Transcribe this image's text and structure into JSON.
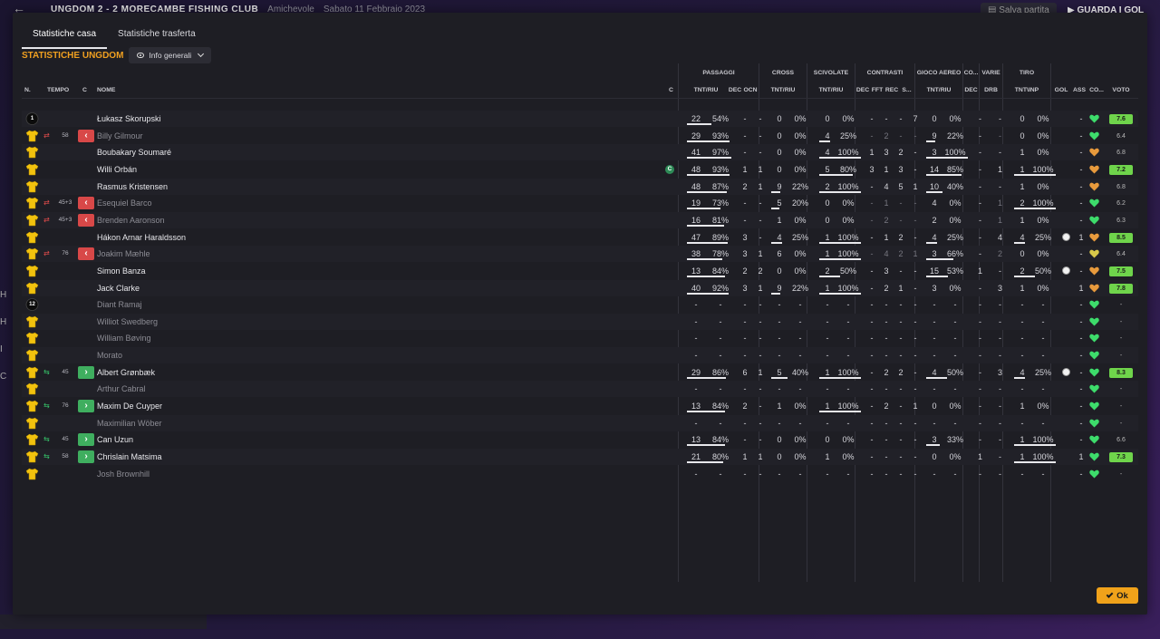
{
  "background": {
    "header_title": "UNGDOM  2 - 2  MORECAMBE FISHING CLUB",
    "header_venue": "Amichevole",
    "header_date": "Sabato 11 Febbraio 2023",
    "save_label": "Salva partita",
    "watch_label": "GUARDA I GOL",
    "left_labels": [
      "H",
      "H",
      "I",
      "C"
    ]
  },
  "tabs": [
    {
      "label": "Statistiche casa",
      "active": true
    },
    {
      "label": "Statistiche trasferta",
      "active": false
    }
  ],
  "team_title": "STATISTICHE UNGDOM",
  "view_dropdown": "Info generali",
  "group_headers": {
    "passaggi": "PASSAGGI",
    "cross": "CROSS",
    "scivolate": "SCIVOLATE",
    "contrasti": "CONTRASTI",
    "gioco_aereo": "GIOCO AEREO",
    "co": "CO...",
    "varie": "VARIE",
    "tiro": "TIRO"
  },
  "column_headers": {
    "num": "N.",
    "tempo": "TEMPO",
    "c": "C",
    "nome": "NOME",
    "cap": "C",
    "pass_tnt": "TNT/RIU",
    "pass_dec": "DEC",
    "pass_ocn": "OCN",
    "cross_tnt": "TNT/RIU",
    "scivolate_tnt": "TNT/RIU",
    "contr_dec": "DEC",
    "contr_fft": "FFT",
    "contr_rec": "REC",
    "contr_s": "S...",
    "aereo_tnt": "TNT/RIU",
    "co_dec": "DEC",
    "varie_drb": "DRB",
    "tiro_tnt": "TNT\\INP",
    "gol": "GOL",
    "ass": "ASS",
    "co2": "CO...",
    "voto": "VOTO"
  },
  "colors": {
    "accent": "#f0a020",
    "sub_out": "#d84848",
    "sub_in": "#3fae5f",
    "rating_high": "#6fd44b",
    "rating_mid": "#b6d44b",
    "rating_low": "#d8d040"
  },
  "players": [
    {
      "num": "1",
      "shirt": "keeper",
      "sub": null,
      "minute": "",
      "name": "Łukasz Skorupski",
      "dim": false,
      "captain": false,
      "pass": [
        "22",
        "54%"
      ],
      "pdec": "-",
      "pocn": "-",
      "cross": [
        "0",
        "0%"
      ],
      "scivolate": [
        "0",
        "0%"
      ],
      "cdec": "-",
      "cfft": "-",
      "crec": "-",
      "cs": "7",
      "aereo": [
        "0",
        "0%"
      ],
      "codec": "-",
      "drb": "-",
      "tiro": [
        "0",
        "0%"
      ],
      "gol": "",
      "ass": "-",
      "heart": "green",
      "rating": "7.6",
      "rating_color": "high"
    },
    {
      "num": "",
      "shirt": "yellow",
      "sub": "out",
      "minute": "58",
      "name": "Billy Gilmour",
      "dim": true,
      "captain": false,
      "pass": [
        "29",
        "93%"
      ],
      "pdec": "-",
      "pocn": "-",
      "cross": [
        "0",
        "0%"
      ],
      "scivolate": [
        "4",
        "25%"
      ],
      "cdec": "-",
      "cfft": "2",
      "crec": "-",
      "cs": "-",
      "aereo": [
        "9",
        "22%"
      ],
      "codec": "-",
      "drb": "-",
      "tiro": [
        "0",
        "0%"
      ],
      "gol": "",
      "ass": "-",
      "heart": "green",
      "rating": "6.4",
      "rating_color": "none"
    },
    {
      "num": "",
      "shirt": "yellow",
      "sub": null,
      "minute": "",
      "name": "Boubakary Soumaré",
      "dim": false,
      "captain": false,
      "pass": [
        "41",
        "97%"
      ],
      "pdec": "-",
      "pocn": "-",
      "cross": [
        "0",
        "0%"
      ],
      "scivolate": [
        "4",
        "100%"
      ],
      "cdec": "1",
      "cfft": "3",
      "crec": "2",
      "cs": "-",
      "aereo": [
        "3",
        "100%"
      ],
      "codec": "-",
      "drb": "-",
      "tiro": [
        "1",
        "0%"
      ],
      "gol": "",
      "ass": "-",
      "heart": "orange",
      "rating": "6.8",
      "rating_color": "none"
    },
    {
      "num": "",
      "shirt": "yellow",
      "sub": null,
      "minute": "",
      "name": "Willi Orbán",
      "dim": false,
      "captain": true,
      "pass": [
        "48",
        "93%"
      ],
      "pdec": "1",
      "pocn": "1",
      "cross": [
        "0",
        "0%"
      ],
      "scivolate": [
        "5",
        "80%"
      ],
      "cdec": "3",
      "cfft": "1",
      "crec": "3",
      "cs": "-",
      "aereo": [
        "14",
        "85%"
      ],
      "codec": "-",
      "drb": "1",
      "tiro": [
        "1",
        "100%"
      ],
      "gol": "",
      "ass": "-",
      "heart": "orange",
      "rating": "7.2",
      "rating_color": "high"
    },
    {
      "num": "",
      "shirt": "yellow",
      "sub": null,
      "minute": "",
      "name": "Rasmus Kristensen",
      "dim": false,
      "captain": false,
      "pass": [
        "48",
        "87%"
      ],
      "pdec": "2",
      "pocn": "1",
      "cross": [
        "9",
        "22%"
      ],
      "scivolate": [
        "2",
        "100%"
      ],
      "cdec": "-",
      "cfft": "4",
      "crec": "5",
      "cs": "1",
      "aereo": [
        "10",
        "40%"
      ],
      "codec": "-",
      "drb": "-",
      "tiro": [
        "1",
        "0%"
      ],
      "gol": "",
      "ass": "-",
      "heart": "orange",
      "rating": "6.8",
      "rating_color": "none"
    },
    {
      "num": "",
      "shirt": "yellow",
      "sub": "out",
      "minute": "45+3",
      "name": "Esequiel Barco",
      "dim": true,
      "captain": false,
      "pass": [
        "19",
        "73%"
      ],
      "pdec": "-",
      "pocn": "-",
      "cross": [
        "5",
        "20%"
      ],
      "scivolate": [
        "0",
        "0%"
      ],
      "cdec": "-",
      "cfft": "1",
      "crec": "-",
      "cs": "-",
      "aereo": [
        "4",
        "0%"
      ],
      "codec": "-",
      "drb": "1",
      "tiro": [
        "2",
        "100%"
      ],
      "gol": "",
      "ass": "-",
      "heart": "green",
      "rating": "6.2",
      "rating_color": "none"
    },
    {
      "num": "",
      "shirt": "yellow",
      "sub": "out",
      "minute": "45+3",
      "name": "Brenden Aaronson",
      "dim": true,
      "captain": false,
      "pass": [
        "16",
        "81%"
      ],
      "pdec": "-",
      "pocn": "-",
      "cross": [
        "1",
        "0%"
      ],
      "scivolate": [
        "0",
        "0%"
      ],
      "cdec": "-",
      "cfft": "2",
      "crec": "-",
      "cs": "-",
      "aereo": [
        "2",
        "0%"
      ],
      "codec": "-",
      "drb": "1",
      "tiro": [
        "1",
        "0%"
      ],
      "gol": "",
      "ass": "-",
      "heart": "green",
      "rating": "6.3",
      "rating_color": "none"
    },
    {
      "num": "",
      "shirt": "yellow",
      "sub": null,
      "minute": "",
      "name": "Hákon Arnar Haraldsson",
      "dim": false,
      "captain": false,
      "pass": [
        "47",
        "89%"
      ],
      "pdec": "3",
      "pocn": "-",
      "cross": [
        "4",
        "25%"
      ],
      "scivolate": [
        "1",
        "100%"
      ],
      "cdec": "-",
      "cfft": "1",
      "crec": "2",
      "cs": "-",
      "aereo": [
        "4",
        "25%"
      ],
      "codec": "-",
      "drb": "4",
      "tiro": [
        "4",
        "25%"
      ],
      "gol": "ball",
      "ass": "1",
      "heart": "orange",
      "rating": "8.5",
      "rating_color": "high"
    },
    {
      "num": "",
      "shirt": "yellow",
      "sub": "out",
      "minute": "76",
      "name": "Joakim Mæhle",
      "dim": true,
      "captain": false,
      "pass": [
        "38",
        "78%"
      ],
      "pdec": "3",
      "pocn": "1",
      "cross": [
        "6",
        "0%"
      ],
      "scivolate": [
        "1",
        "100%"
      ],
      "cdec": "-",
      "cfft": "4",
      "crec": "2",
      "cs": "1",
      "aereo": [
        "3",
        "66%"
      ],
      "codec": "-",
      "drb": "2",
      "tiro": [
        "0",
        "0%"
      ],
      "gol": "",
      "ass": "-",
      "heart": "yellow",
      "rating": "6.4",
      "rating_color": "none"
    },
    {
      "num": "",
      "shirt": "yellow",
      "sub": null,
      "minute": "",
      "name": "Simon Banza",
      "dim": false,
      "captain": false,
      "pass": [
        "13",
        "84%"
      ],
      "pdec": "2",
      "pocn": "2",
      "cross": [
        "0",
        "0%"
      ],
      "scivolate": [
        "2",
        "50%"
      ],
      "cdec": "-",
      "cfft": "3",
      "crec": "-",
      "cs": "-",
      "aereo": [
        "15",
        "53%"
      ],
      "codec": "1",
      "drb": "-",
      "tiro": [
        "2",
        "50%"
      ],
      "gol": "ball",
      "ass": "-",
      "heart": "orange",
      "rating": "7.5",
      "rating_color": "high"
    },
    {
      "num": "",
      "shirt": "yellow",
      "sub": null,
      "minute": "",
      "name": "Jack Clarke",
      "dim": false,
      "captain": false,
      "pass": [
        "40",
        "92%"
      ],
      "pdec": "3",
      "pocn": "1",
      "cross": [
        "9",
        "22%"
      ],
      "scivolate": [
        "1",
        "100%"
      ],
      "cdec": "-",
      "cfft": "2",
      "crec": "1",
      "cs": "-",
      "aereo": [
        "3",
        "0%"
      ],
      "codec": "-",
      "drb": "3",
      "tiro": [
        "1",
        "0%"
      ],
      "gol": "",
      "ass": "1",
      "heart": "orange",
      "rating": "7.8",
      "rating_color": "high"
    },
    {
      "num": "12",
      "shirt": "keeper",
      "sub": null,
      "minute": "",
      "name": "Diant Ramaj",
      "dim": true,
      "captain": false,
      "empty": true,
      "heart": "green",
      "rating": "-",
      "rating_color": "none"
    },
    {
      "num": "",
      "shirt": "yellow",
      "sub": null,
      "minute": "",
      "name": "Williot Swedberg",
      "dim": true,
      "captain": false,
      "empty": true,
      "heart": "green",
      "rating": "-",
      "rating_color": "none"
    },
    {
      "num": "",
      "shirt": "yellow",
      "sub": null,
      "minute": "",
      "name": "William Bøving",
      "dim": true,
      "captain": false,
      "empty": true,
      "heart": "green",
      "rating": "-",
      "rating_color": "none"
    },
    {
      "num": "",
      "shirt": "yellow",
      "sub": null,
      "minute": "",
      "name": "Morato",
      "dim": true,
      "captain": false,
      "empty": true,
      "heart": "green",
      "rating": "-",
      "rating_color": "none"
    },
    {
      "num": "",
      "shirt": "yellow",
      "sub": "in",
      "minute": "45",
      "name": "Albert Grønbæk",
      "dim": false,
      "captain": false,
      "pass": [
        "29",
        "86%"
      ],
      "pdec": "6",
      "pocn": "1",
      "cross": [
        "5",
        "40%"
      ],
      "scivolate": [
        "1",
        "100%"
      ],
      "cdec": "-",
      "cfft": "2",
      "crec": "2",
      "cs": "-",
      "aereo": [
        "4",
        "50%"
      ],
      "codec": "-",
      "drb": "3",
      "tiro": [
        "4",
        "25%"
      ],
      "gol": "ball",
      "ass": "-",
      "heart": "green",
      "rating": "8.3",
      "rating_color": "high"
    },
    {
      "num": "",
      "shirt": "yellow",
      "sub": null,
      "minute": "",
      "name": "Arthur Cabral",
      "dim": true,
      "captain": false,
      "empty": true,
      "heart": "green",
      "rating": "-",
      "rating_color": "none"
    },
    {
      "num": "",
      "shirt": "yellow",
      "sub": "in",
      "minute": "76",
      "name": "Maxim De Cuyper",
      "dim": false,
      "captain": false,
      "pass": [
        "13",
        "84%"
      ],
      "pdec": "2",
      "pocn": "-",
      "cross": [
        "1",
        "0%"
      ],
      "scivolate": [
        "1",
        "100%"
      ],
      "cdec": "-",
      "cfft": "2",
      "crec": "-",
      "cs": "1",
      "aereo": [
        "0",
        "0%"
      ],
      "codec": "-",
      "drb": "-",
      "tiro": [
        "1",
        "0%"
      ],
      "gol": "",
      "ass": "-",
      "heart": "green",
      "rating": "-",
      "rating_color": "none"
    },
    {
      "num": "",
      "shirt": "yellow",
      "sub": null,
      "minute": "",
      "name": "Maximilian Wöber",
      "dim": true,
      "captain": false,
      "empty": true,
      "heart": "green",
      "rating": "-",
      "rating_color": "none"
    },
    {
      "num": "",
      "shirt": "yellow",
      "sub": "in",
      "minute": "45",
      "name": "Can Uzun",
      "dim": false,
      "captain": false,
      "pass": [
        "13",
        "84%"
      ],
      "pdec": "-",
      "pocn": "-",
      "cross": [
        "0",
        "0%"
      ],
      "scivolate": [
        "0",
        "0%"
      ],
      "cdec": "-",
      "cfft": "-",
      "crec": "-",
      "cs": "-",
      "aereo": [
        "3",
        "33%"
      ],
      "codec": "-",
      "drb": "-",
      "tiro": [
        "1",
        "100%"
      ],
      "gol": "",
      "ass": "-",
      "heart": "green",
      "rating": "6.6",
      "rating_color": "none"
    },
    {
      "num": "",
      "shirt": "yellow",
      "sub": "in",
      "minute": "58",
      "name": "Chrislain Matsima",
      "dim": false,
      "captain": false,
      "pass": [
        "21",
        "80%"
      ],
      "pdec": "1",
      "pocn": "1",
      "cross": [
        "0",
        "0%"
      ],
      "scivolate": [
        "1",
        "0%"
      ],
      "cdec": "-",
      "cfft": "-",
      "crec": "-",
      "cs": "-",
      "aereo": [
        "0",
        "0%"
      ],
      "codec": "1",
      "drb": "-",
      "tiro": [
        "1",
        "100%"
      ],
      "gol": "",
      "ass": "1",
      "heart": "green",
      "rating": "7.3",
      "rating_color": "high"
    },
    {
      "num": "",
      "shirt": "yellow",
      "sub": null,
      "minute": "",
      "name": "Josh Brownhill",
      "dim": true,
      "captain": false,
      "empty": true,
      "heart": "green",
      "rating": "-",
      "rating_color": "none"
    }
  ],
  "ok_label": "Ok"
}
